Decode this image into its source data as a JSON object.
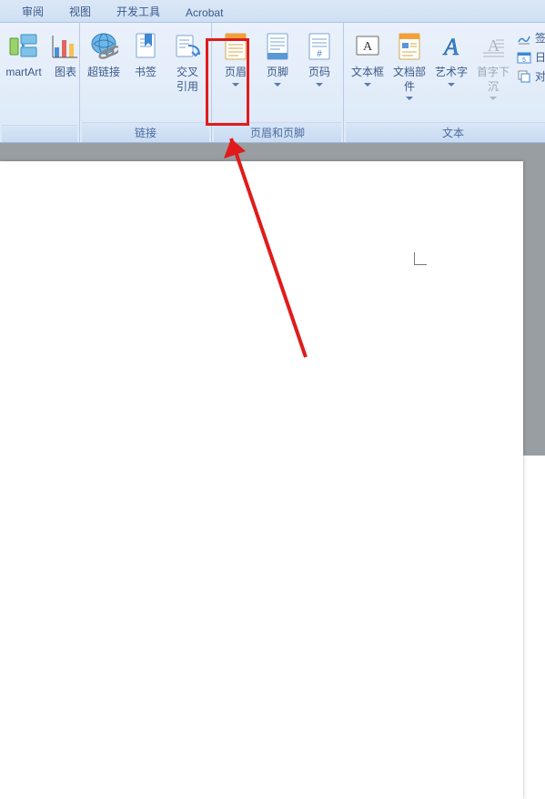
{
  "tabs": [
    {
      "label": "审阅"
    },
    {
      "label": "视图"
    },
    {
      "label": "开发工具"
    },
    {
      "label": "Acrobat"
    }
  ],
  "groups": {
    "partial_left": {
      "smartart": "martArt",
      "chart": "图表"
    },
    "links": {
      "label": "链接",
      "hyperlink": "超链接",
      "bookmark": "书签",
      "crossref": "交叉\n引用"
    },
    "header_footer": {
      "label": "页眉和页脚",
      "header": "页眉",
      "footer": "页脚",
      "pagenum": "页码"
    },
    "text": {
      "label": "文本",
      "textbox": "文本框",
      "quickparts": "文档部件",
      "wordart": "艺术字",
      "dropcap": "首字下沉"
    },
    "right_mini": {
      "signature": "签名",
      "datetime": "日期",
      "object": "对象"
    }
  }
}
